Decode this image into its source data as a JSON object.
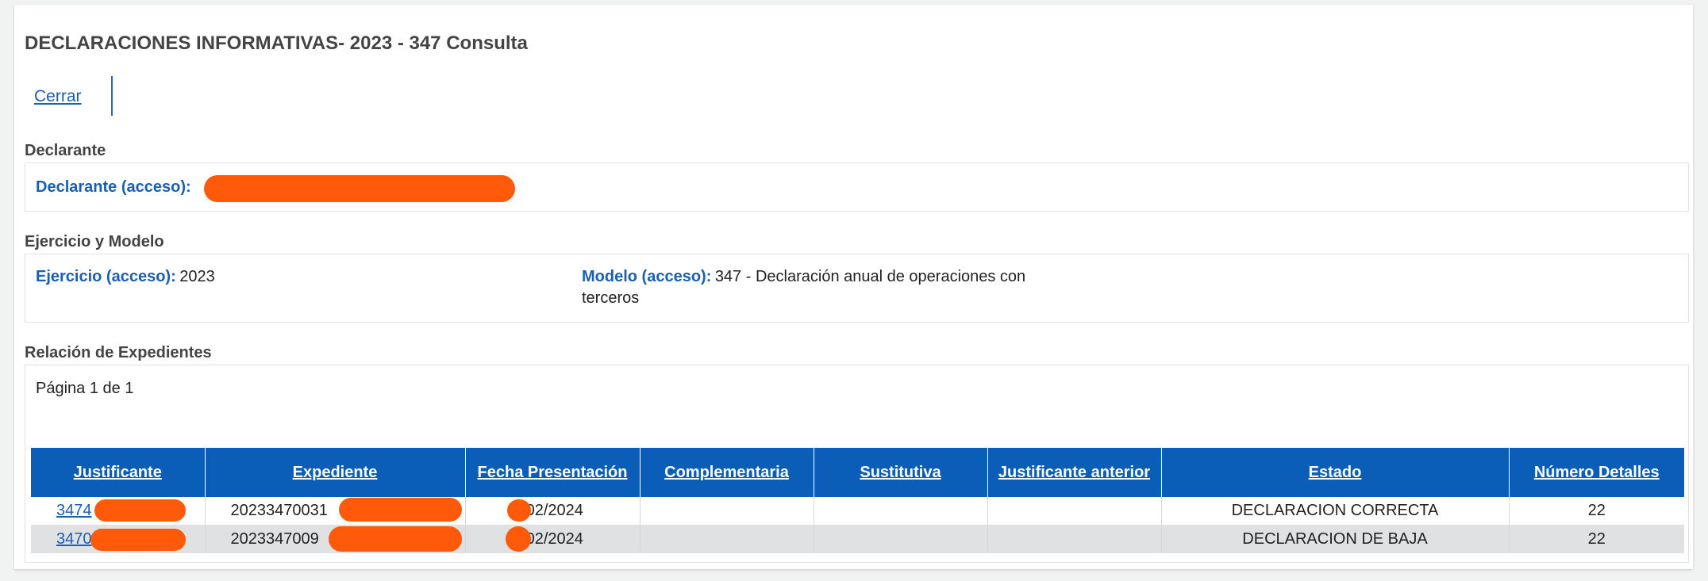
{
  "page": {
    "title": "DECLARACIONES INFORMATIVAS- 2023 - 347 Consulta",
    "close_label": "Cerrar"
  },
  "declarante": {
    "section_label": "Declarante",
    "field_label": "Declarante (acceso):"
  },
  "ejercicio_modelo": {
    "section_label": "Ejercicio y Modelo",
    "ejercicio_label": "Ejercicio (acceso):",
    "ejercicio_value": "2023",
    "modelo_label": "Modelo (acceso):",
    "modelo_value_line1": "347 - Declaración anual de operaciones con",
    "modelo_value_line2": "terceros"
  },
  "expedientes": {
    "section_label": "Relación de Expedientes",
    "page_info": "Página 1 de 1",
    "columns": [
      "Justificante",
      "Expediente",
      "Fecha Presentación",
      "Complementaria",
      "Sustitutiva",
      "Justificante anterior",
      "Estado",
      "Número Detalles"
    ],
    "rows": [
      {
        "justificante": "3474",
        "expediente": "20233470031",
        "fecha": "/02/2024",
        "complementaria": "",
        "sustitutiva": "",
        "justificante_anterior": "",
        "estado": "DECLARACION CORRECTA",
        "numero_detalles": "22"
      },
      {
        "justificante": "3470",
        "expediente": "2023347009",
        "fecha": "/02/2024",
        "complementaria": "",
        "sustitutiva": "",
        "justificante_anterior": "",
        "estado": "DECLARACION DE BAJA",
        "numero_detalles": "22"
      }
    ]
  },
  "colors": {
    "accent": "#1a5fb4",
    "table_header": "#0b5eb8",
    "redaction": "#ff5a0a"
  }
}
